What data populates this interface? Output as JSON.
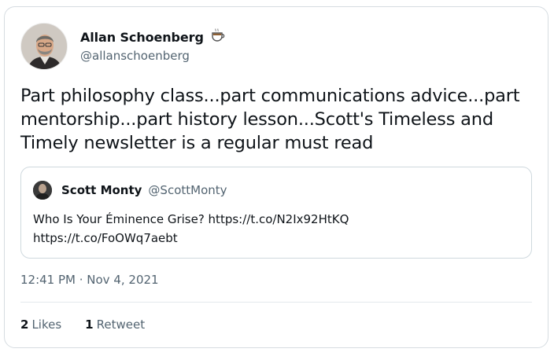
{
  "author": {
    "display_name": "Allan Schoenberg",
    "handle": "@allanschoenberg",
    "name_emoji": "coffee-icon"
  },
  "tweet": {
    "text": "Part philosophy class...part communications advice...part mentorship...part history lesson...Scott's Timeless and Timely newsletter is a regular must read"
  },
  "quoted_tweet": {
    "display_name": "Scott Monty",
    "handle": "@ScottMonty",
    "text_line1": "Who Is Your Éminence Grise? https://t.co/N2Ix92HtKQ",
    "text_line2": "https://t.co/FoOWq7aebt"
  },
  "timestamp": "12:41 PM · Nov 4, 2021",
  "stats": {
    "likes_count": "2",
    "likes_label": "Likes",
    "retweets_count": "1",
    "retweets_label": "Retweet"
  }
}
